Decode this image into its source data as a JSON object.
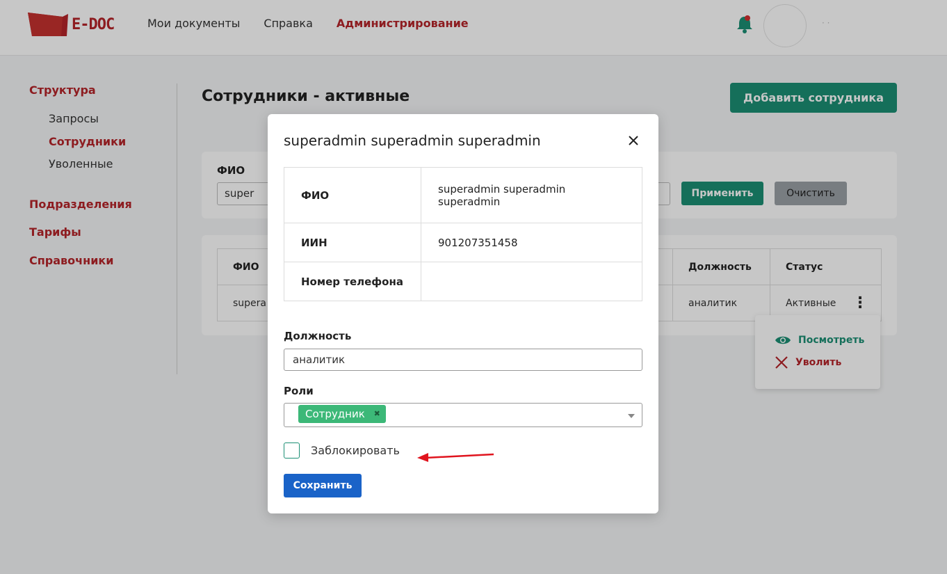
{
  "header": {
    "logo_text": "E-DOC",
    "nav": [
      "Мои документы",
      "Справка",
      "Администрирование"
    ],
    "username": "· ·"
  },
  "sidebar": {
    "structure": "Структура",
    "structure_items": [
      "Запросы",
      "Сотрудники",
      "Уволенные"
    ],
    "sections": [
      "Подразделения",
      "Тарифы",
      "Справочники"
    ]
  },
  "main": {
    "title": "Сотрудники - активные",
    "add_button": "Добавить сотрудника",
    "filter": {
      "label": "ФИО",
      "value": "super",
      "apply": "Применить",
      "clear": "Очистить"
    },
    "table": {
      "headers": [
        "ФИО",
        "",
        "Должность",
        "Статус"
      ],
      "rows": [
        [
          "supera",
          "",
          "аналитик",
          "Активные"
        ]
      ]
    },
    "menu": {
      "view": "Посмотреть",
      "fire": "Уволить"
    }
  },
  "modal": {
    "title": "superadmin superadmin superadmin",
    "info": [
      {
        "key": "ФИО",
        "value": "superadmin superadmin superadmin"
      },
      {
        "key": "ИИН",
        "value": "901207351458"
      },
      {
        "key": "Номер телефона",
        "value": ""
      }
    ],
    "position_label": "Должность",
    "position_value": "аналитик",
    "roles_label": "Роли",
    "roles": [
      "Сотрудник"
    ],
    "block_label": "Заблокировать",
    "block_checked": false,
    "save": "Сохранить"
  },
  "colors": {
    "brand_red": "#b5242a",
    "green": "#1b8f74",
    "tag_green": "#3cb878",
    "save_blue": "#1a63c8"
  }
}
